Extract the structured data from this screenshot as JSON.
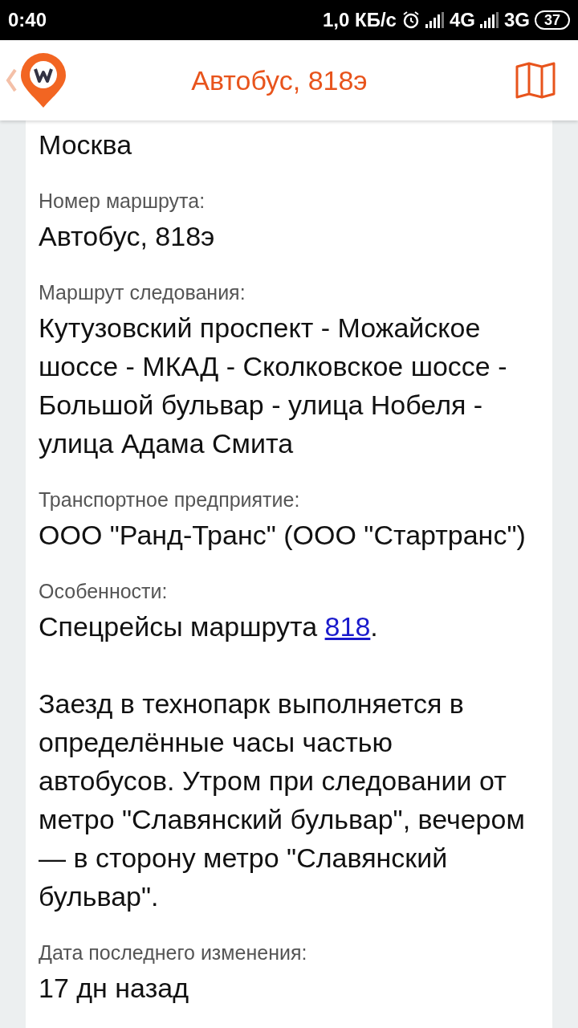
{
  "status_bar": {
    "time": "0:40",
    "speed": "1,0 КБ/с",
    "network_1": "4G",
    "network_2": "3G",
    "battery": "37"
  },
  "header": {
    "title": "Автобус, 818э"
  },
  "details": [
    {
      "kind": "value",
      "value": "Москва"
    },
    {
      "kind": "field",
      "label": "Номер маршрута:",
      "value": "Автобус, 818э"
    },
    {
      "kind": "field",
      "label": "Маршрут следования:",
      "value": "Кутузовский проспект - Можайское шоссе - МКАД - Сколковское шоссе - Большой бульвар - улица Нобеля - улица Адама Смита"
    },
    {
      "kind": "field",
      "label": "Транспортное предприятие:",
      "value": "ООО \"Ранд-Транс\" (ООО \"Стартранс\")"
    },
    {
      "kind": "features",
      "label": "Особенности:",
      "before": "Спецрейсы маршрута ",
      "link": "818",
      "after": ".",
      "paragraph": "Заезд в технопарк выполняется в определённые часы частью автобусов. Утром при следовании от метро \"Славянский бульвар\", вечером — в сторону метро \"Славянский бульвар\"."
    },
    {
      "kind": "field",
      "label": "Дата последнего изменения:",
      "value": "17 дн назад"
    }
  ]
}
